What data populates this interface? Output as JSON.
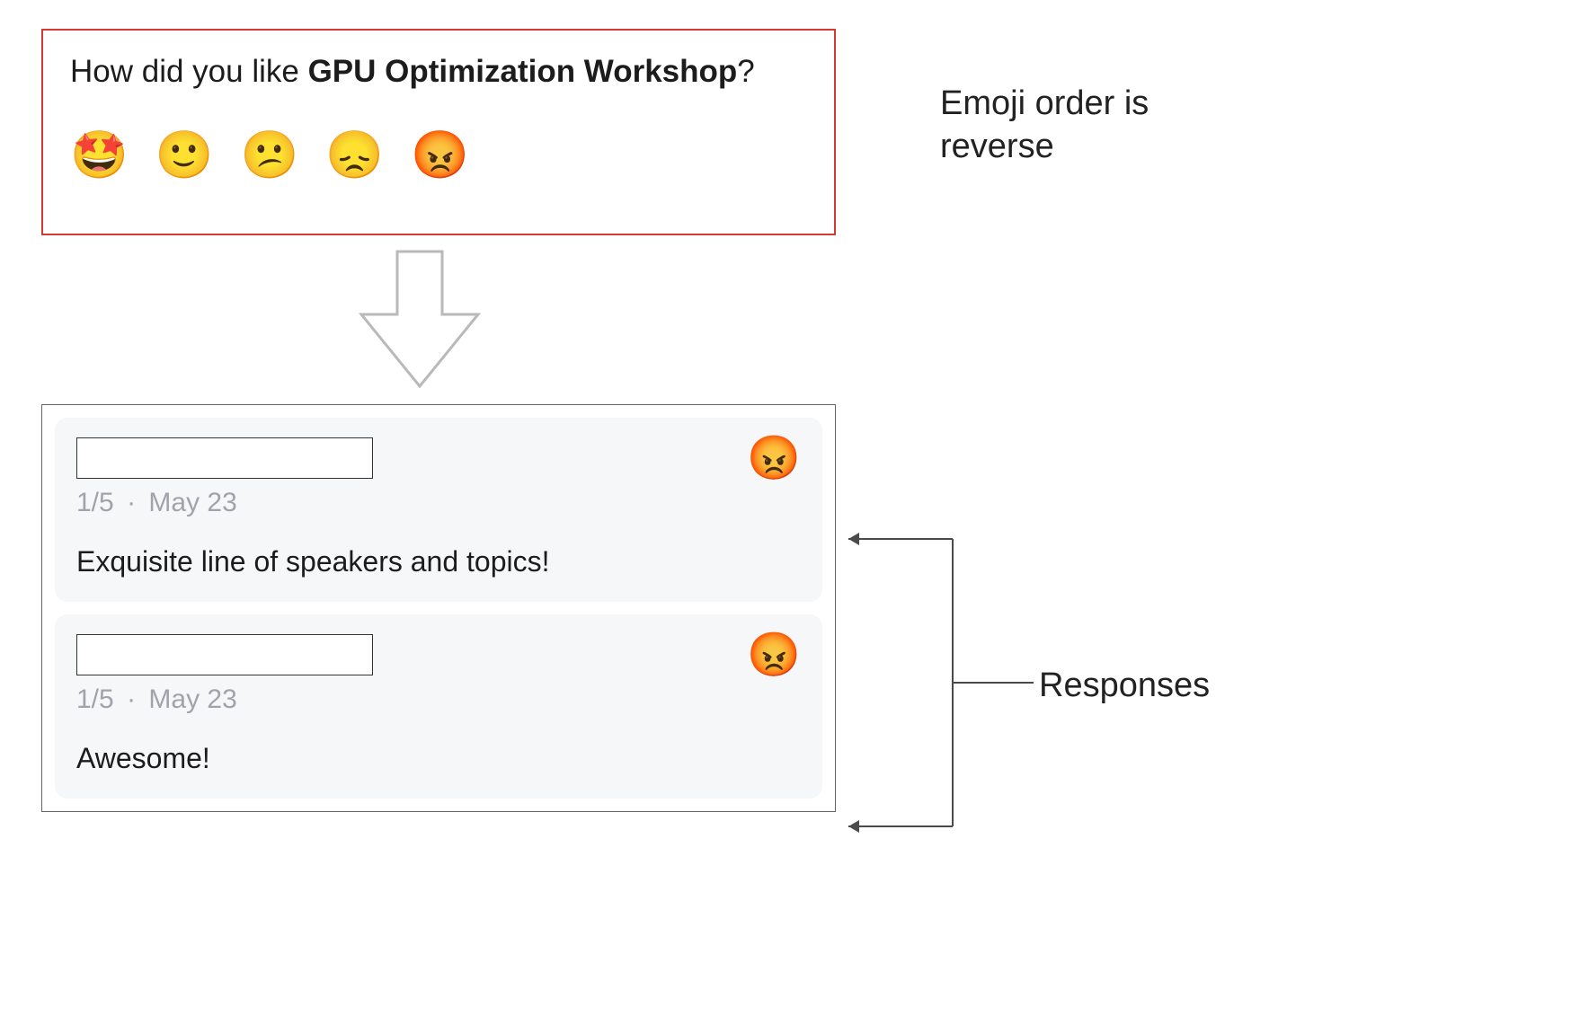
{
  "prompt": {
    "prefix": "How did you like ",
    "bold": "GPU Optimization Workshop",
    "suffix": "?",
    "emojis": [
      "🤩",
      "🙂",
      "😕",
      "😞",
      "😡"
    ]
  },
  "responses": [
    {
      "score": "1/5",
      "date": "May 23",
      "text": "Exquisite line of speakers and topics!",
      "reaction": "😡"
    },
    {
      "score": "1/5",
      "date": "May 23",
      "text": "Awesome!",
      "reaction": "😡"
    }
  ],
  "annotations": {
    "emoji_order": "Emoji order is reverse",
    "responses_label": "Responses"
  },
  "meta_separator": "·"
}
